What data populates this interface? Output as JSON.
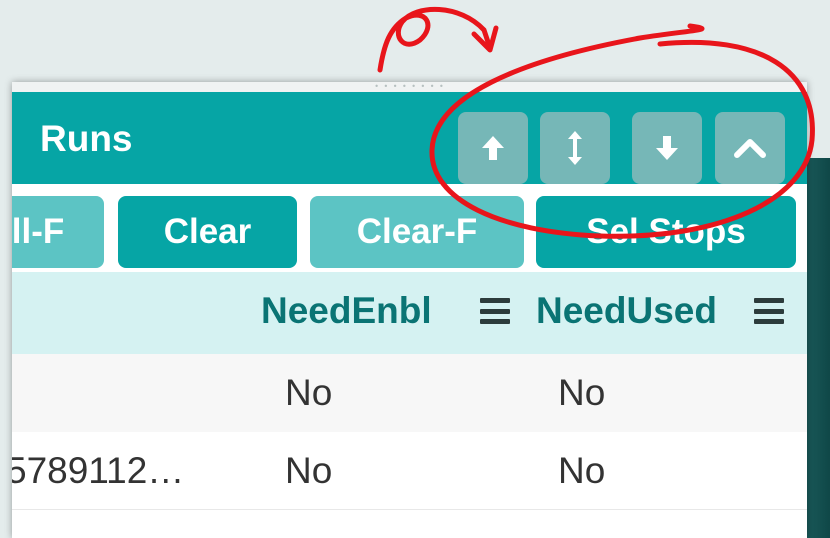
{
  "panel": {
    "title": "Runs",
    "nav_buttons": [
      {
        "icon": "arrow-up-icon"
      },
      {
        "icon": "arrow-up-down-icon"
      },
      {
        "icon": "arrow-down-icon"
      },
      {
        "icon": "chevron-up-icon"
      }
    ],
    "toolbar": {
      "buttons": [
        {
          "label": "ll-F",
          "style": "light"
        },
        {
          "label": "Clear",
          "style": "dark"
        },
        {
          "label": "Clear-F",
          "style": "light"
        },
        {
          "label": "Sel Stops",
          "style": "dark"
        }
      ]
    },
    "columns": [
      {
        "label": "NeedEnbl"
      },
      {
        "label": "NeedUsed"
      }
    ],
    "rows": [
      {
        "first": "",
        "need_enbl": "No",
        "need_used": "No"
      },
      {
        "first": "5789112…",
        "need_enbl": "No",
        "need_used": "No"
      }
    ]
  },
  "colors": {
    "header": "#06a5a5",
    "button_dark": "#06a5a5",
    "button_light": "#5cc4c4",
    "nav_button": "#76b7b7",
    "column_header_bg": "#d5f2f2",
    "column_header_text": "#0a7474",
    "annotation": "#e8151b"
  }
}
